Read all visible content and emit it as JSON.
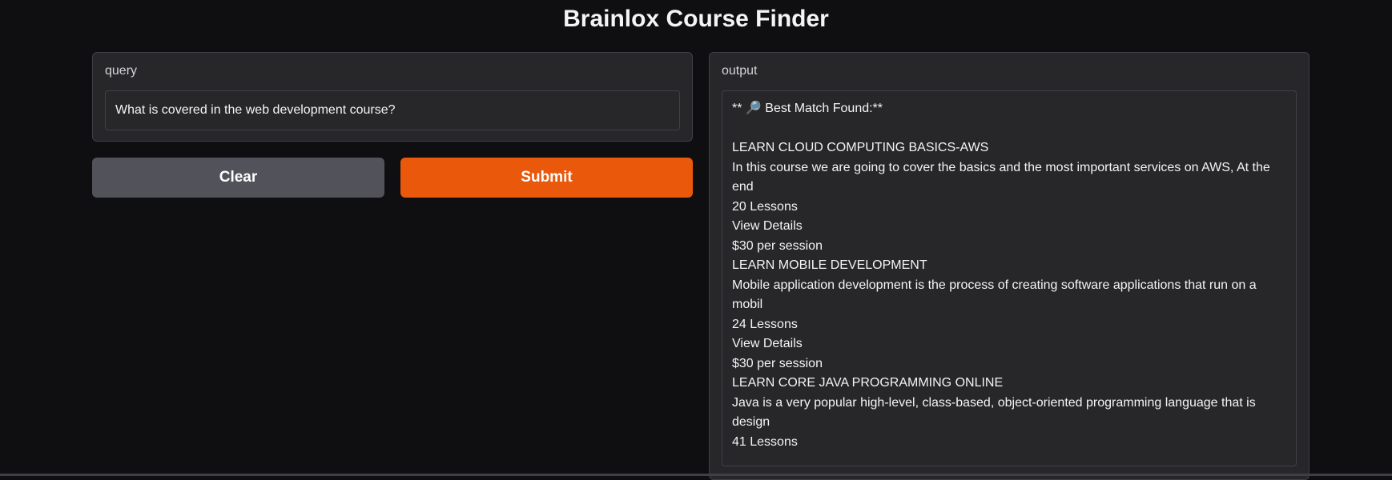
{
  "app": {
    "title": "Brainlox Course Finder"
  },
  "query": {
    "label": "query",
    "value": "What is covered in the web development course?"
  },
  "buttons": {
    "clear_label": "Clear",
    "submit_label": "Submit"
  },
  "output": {
    "label": "output",
    "lines": [
      "** 🔎 Best Match Found:**",
      "",
      "LEARN CLOUD COMPUTING BASICS-AWS",
      "In this course we are going to cover the basics and the most important services on AWS, At the end",
      "20 Lessons",
      "View Details",
      "$30 per session",
      "LEARN MOBILE DEVELOPMENT",
      "Mobile application development is the process of creating software applications that run on a mobil",
      "24 Lessons",
      "View Details",
      "$30 per session",
      "LEARN CORE JAVA PROGRAMMING ONLINE",
      "Java is a very popular high-level, class-based, object-oriented programming language that is design",
      "41 Lessons"
    ]
  },
  "colors": {
    "background": "#0f0f11",
    "panel": "#27272a",
    "border": "#3f3f46",
    "clear_button": "#52525b",
    "submit_button": "#ea580c",
    "text": "#f4f4f5"
  }
}
